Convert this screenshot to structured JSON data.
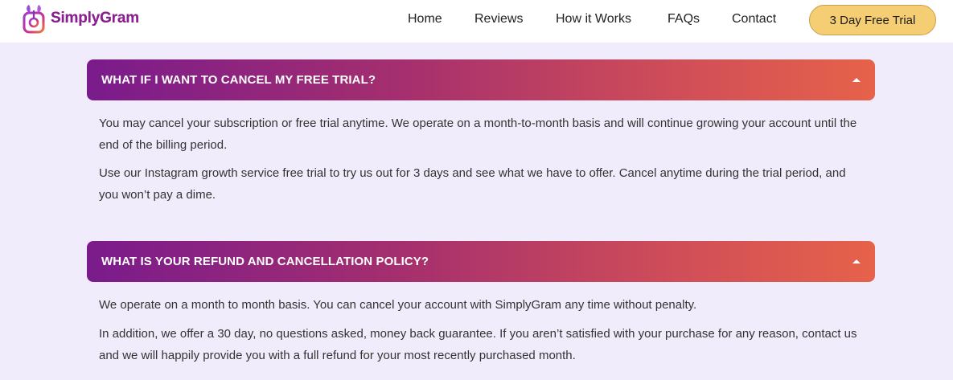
{
  "brand": {
    "name": "SimplyGram",
    "logo_icon": "simplygram-logo-icon"
  },
  "nav": {
    "items": [
      {
        "label": "Home"
      },
      {
        "label": "Reviews"
      },
      {
        "label": "How it Works"
      },
      {
        "label": "FAQs"
      },
      {
        "label": "Contact"
      }
    ],
    "cta_label": "3 Day Free Trial"
  },
  "faqs": [
    {
      "question": "WHAT IF I WANT TO CANCEL MY FREE TRIAL?",
      "expanded": true,
      "paragraphs": [
        "You may cancel your subscription or free trial anytime. We operate on a month-to-month basis and will continue growing your account until the end of the billing period.",
        "Use our Instagram growth service free trial to try us out for 3 days and see what we have to offer. Cancel anytime during the trial period, and you won’t pay a dime."
      ]
    },
    {
      "question": "WHAT IS YOUR REFUND AND CANCELLATION POLICY?",
      "expanded": true,
      "paragraphs": [
        "We operate on a month to month basis. You can cancel your account with SimplyGram any time without penalty.",
        "In addition, we offer a 30 day, no questions asked, money back guarantee. If you aren’t satisfied with your purchase for any reason, contact us and we will happily provide you with a full refund for your most recently purchased month."
      ]
    }
  ],
  "colors": {
    "page_bg": "#f1ecfb",
    "accordion_gradient_start": "#7a1b8c",
    "accordion_gradient_end": "#e6624a",
    "cta_bg": "#f5cd72"
  }
}
